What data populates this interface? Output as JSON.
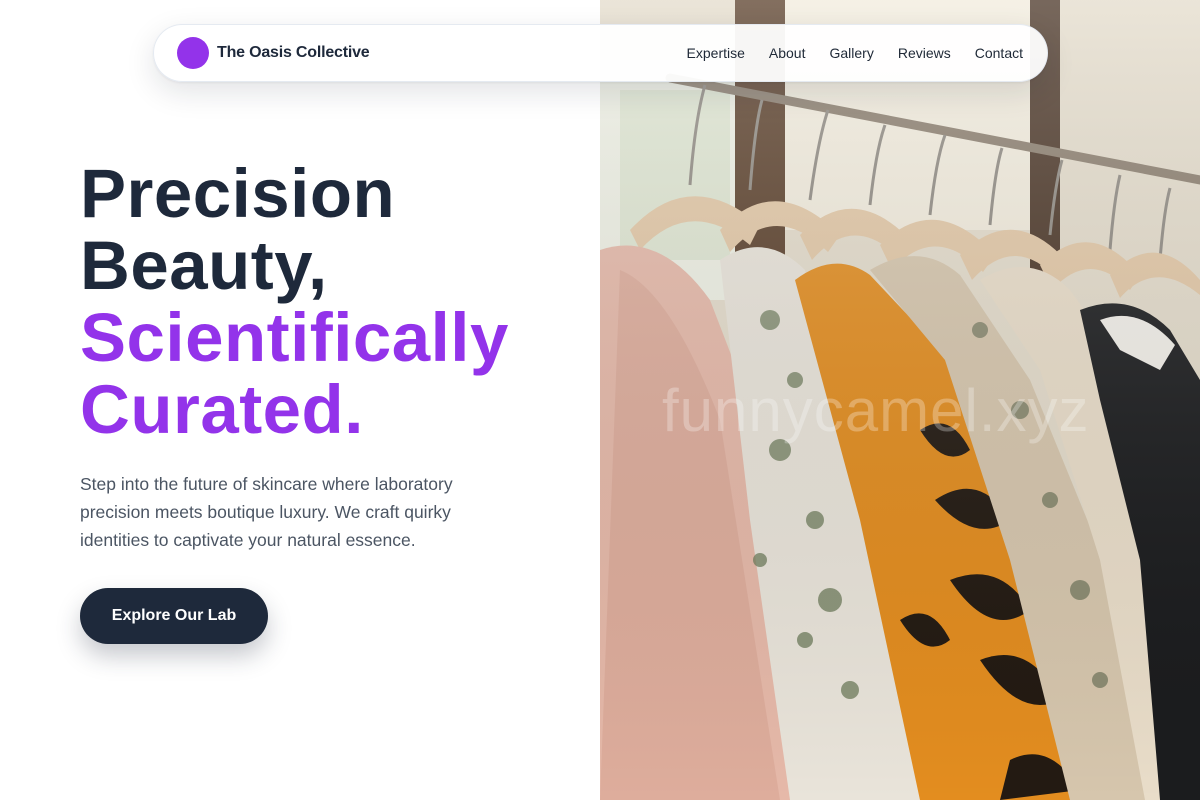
{
  "brand": {
    "name": "The Oasis Collective",
    "accent": "#9333ea"
  },
  "nav": {
    "items": [
      {
        "label": "Expertise"
      },
      {
        "label": "About"
      },
      {
        "label": "Gallery"
      },
      {
        "label": "Reviews"
      },
      {
        "label": "Contact"
      }
    ]
  },
  "hero": {
    "title_line1": "Precision",
    "title_line2": "Beauty,",
    "title_line3": "Scientifically",
    "title_line4": "Curated.",
    "subtitle": "Step into the future of skincare where laboratory precision meets boutique luxury. We craft quirky identities to captivate your natural essence.",
    "cta_label": "Explore Our Lab",
    "image_alt": "Clothing rack with garments on wooden hangers"
  },
  "watermark": "funnycamel.xyz",
  "colors": {
    "dark": "#1e293b",
    "accent": "#9333ea",
    "body_text": "#4b5563"
  }
}
